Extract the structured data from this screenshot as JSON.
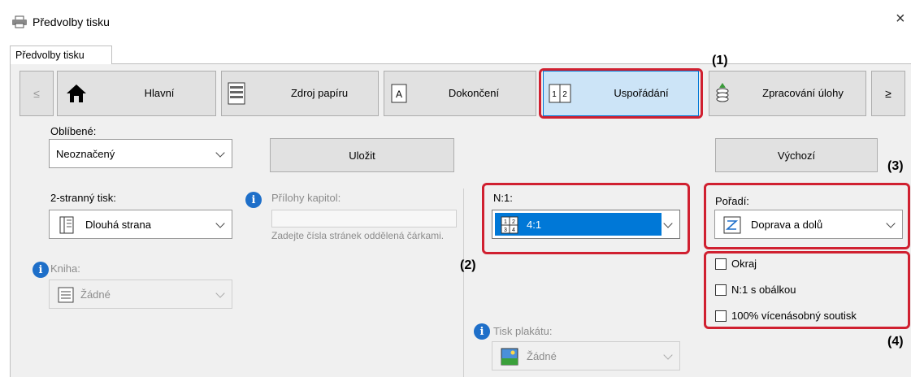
{
  "window": {
    "title": "Předvolby tisku",
    "close_glyph": "×"
  },
  "tab": {
    "label": "Předvolby tisku"
  },
  "nav": {
    "prev_glyph": "≤",
    "next_glyph": "≥",
    "buttons": [
      {
        "label": "Hlavní",
        "icon": "home-icon"
      },
      {
        "label": "Zdroj papíru",
        "icon": "paper-tray-icon"
      },
      {
        "label": "Dokončení",
        "icon": "finishing-icon"
      },
      {
        "label": "Uspořádání",
        "icon": "layout-icon",
        "selected": true
      },
      {
        "label": "Zpracování úlohy",
        "icon": "job-handling-icon"
      }
    ]
  },
  "favorites": {
    "label": "Oblíbené:",
    "value": "Neoznačený",
    "save_label": "Uložit",
    "default_label": "Výchozí"
  },
  "duplex": {
    "label": "2-stranný tisk:",
    "value": "Dlouhá strana"
  },
  "chapters": {
    "label": "Přílohy kapitol:",
    "hint": "Zadejte čísla stránek oddělená čárkami."
  },
  "book": {
    "label": "Kniha:",
    "value": "Žádné"
  },
  "nup": {
    "label": "N:1:",
    "value": "4:1"
  },
  "order": {
    "label": "Pořadí:",
    "value": "Doprava a dolů"
  },
  "checkboxes": [
    {
      "label": "Okraj",
      "checked": false
    },
    {
      "label": "N:1 s obálkou",
      "checked": false
    },
    {
      "label": "100% vícenásobný soutisk",
      "checked": false
    }
  ],
  "poster": {
    "label": "Tisk plakátu:",
    "value": "Žádné"
  },
  "callouts": {
    "c1": "(1)",
    "c2": "(2)",
    "c3": "(3)",
    "c4": "(4)"
  },
  "colors": {
    "accent": "#0078d7",
    "selected_bg": "#cce4f7",
    "highlight": "#d02030",
    "info": "#1e6fc9"
  }
}
